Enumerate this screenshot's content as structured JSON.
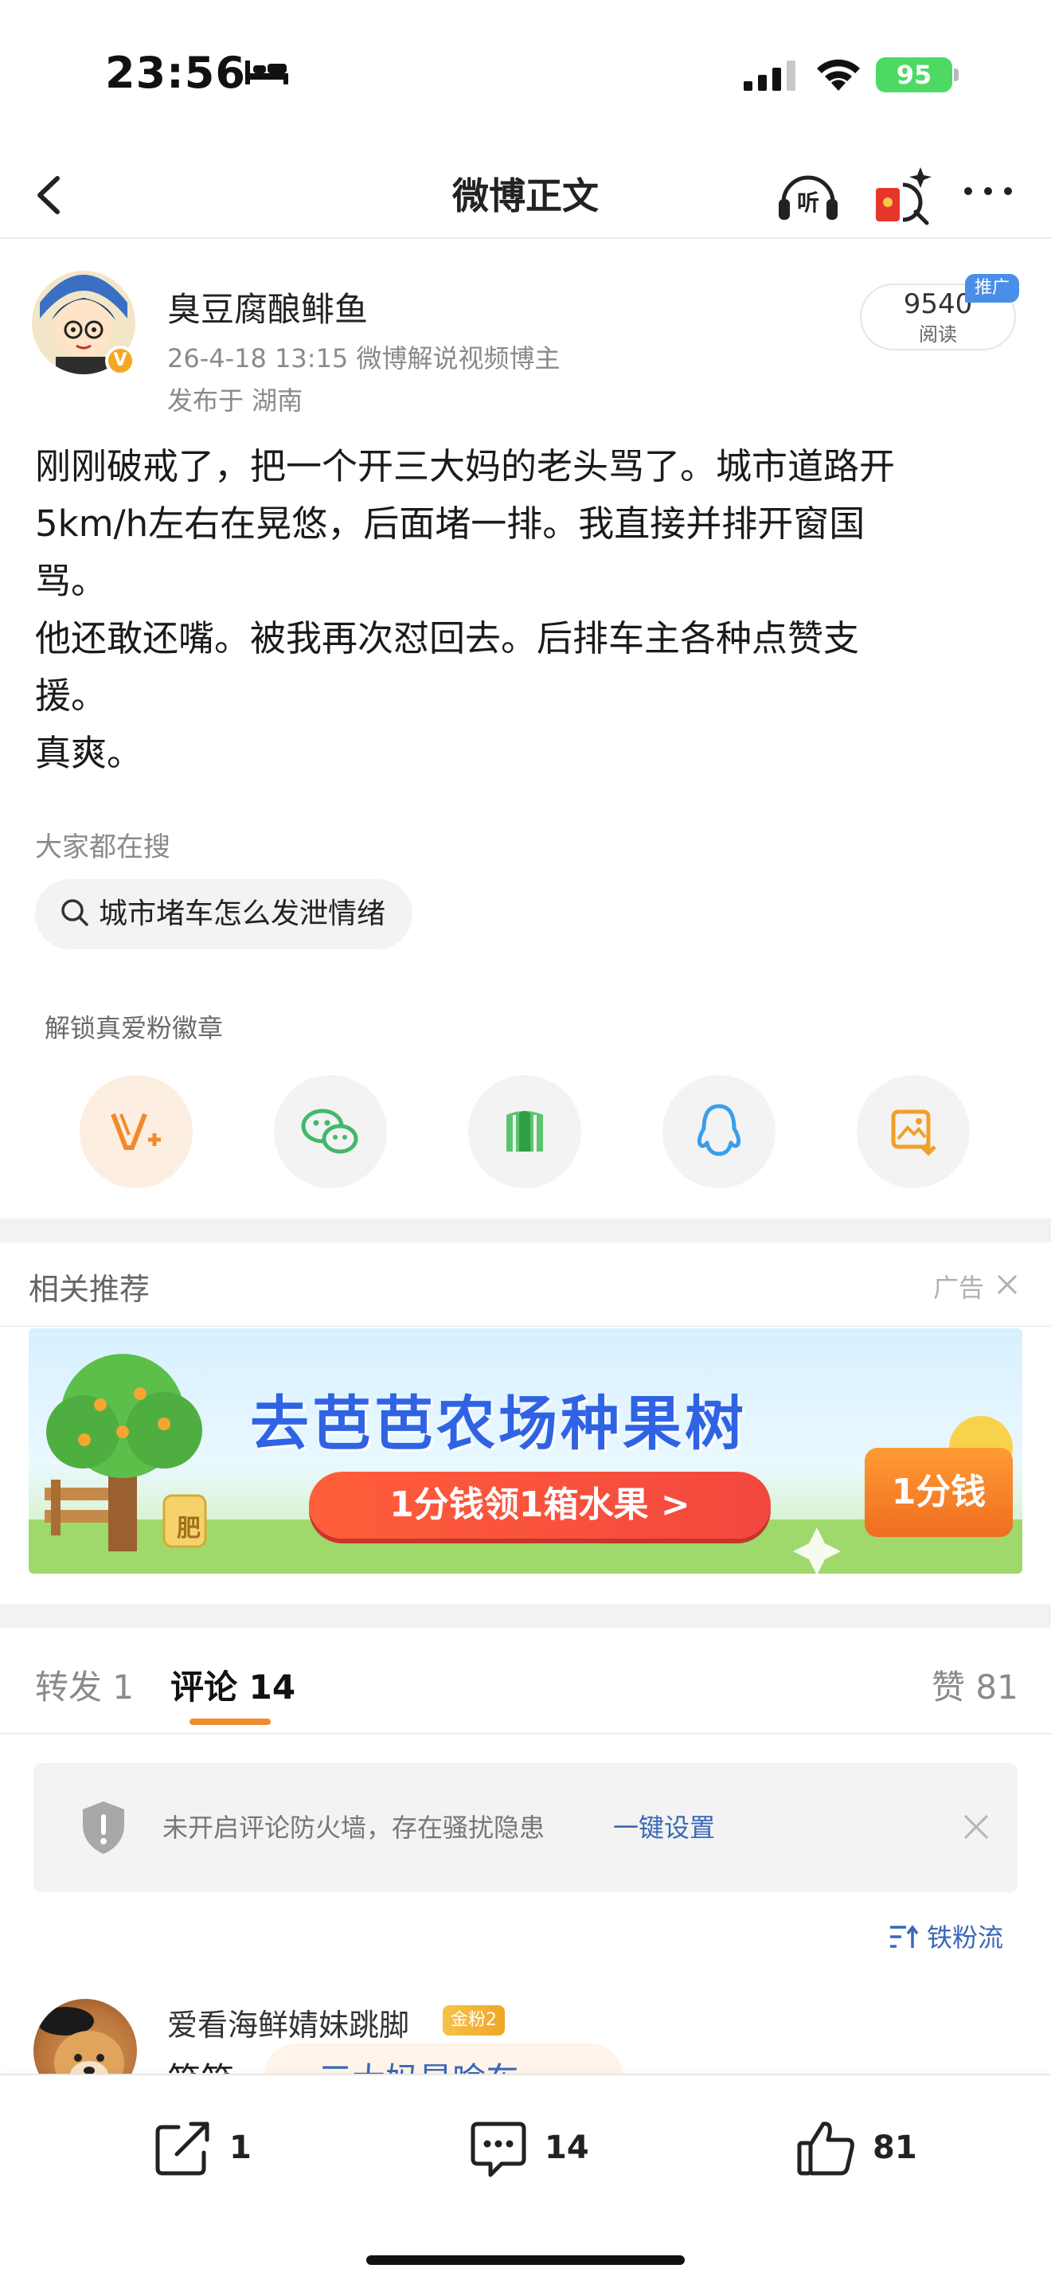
{
  "status_bar": {
    "time": "23:56",
    "battery": "95"
  },
  "nav": {
    "title": "微博正文"
  },
  "post": {
    "author": "臭豆腐酿鲱鱼",
    "meta": "26-4-18 13:15  微博解说视频博主",
    "location": "发布于 湖南",
    "read_count": "9540",
    "read_label": "阅读",
    "promo_tag": "推广",
    "body": "刚刚破戒了，把一个开三大妈的老头骂了。城市道路开\n5km/h左右在晃悠，后面堵一排。我直接并排开窗国\n骂。\n他还敢还嘴。被我再次怼回去。后排车主各种点赞支\n援。\n真爽。"
  },
  "hot_search": {
    "label": "大家都在搜",
    "query": "城市堵车怎么发泄情绪"
  },
  "share": {
    "unlock_label": "解锁真爱粉徽章",
    "icons": [
      "vplus-icon",
      "wechat-icon",
      "moments-icon",
      "qq-icon",
      "save-image-icon"
    ]
  },
  "recommend": {
    "title": "相关推荐",
    "ad_label": "广告",
    "banner_title": "去芭芭农场种果树",
    "banner_cta": "1分钱领1箱水果 >",
    "banner_badge": "1分钱",
    "banner_fert": "肥"
  },
  "tabs": {
    "repost": "转发 1",
    "comment": "评论 14",
    "like": "赞 81"
  },
  "notice": {
    "text": "未开启评论防火墙，存在骚扰隐患",
    "link": "一键设置"
  },
  "sort": {
    "label": "铁粉流"
  },
  "comment": {
    "user": "爱看海鲜婧妹跳脚",
    "badge": "金粉2",
    "text_prefix": "笑笑",
    "search_text": "三大妈是啥车"
  },
  "bottom": {
    "repost_count": "1",
    "comment_count": "14",
    "like_count": "81"
  },
  "colors": {
    "accent": "#f08a2c",
    "link": "#3a68b8",
    "ad_blue": "#2f63e3"
  }
}
